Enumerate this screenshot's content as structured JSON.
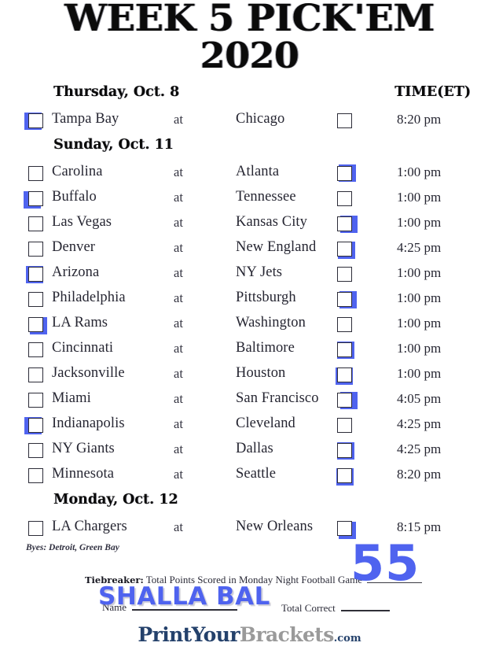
{
  "title": {
    "line1": "WEEK 5 PICK'EM",
    "line2": "2020"
  },
  "columns": {
    "time_header": "TIME(ET)",
    "at_word": "at"
  },
  "days": [
    {
      "label": "Thursday, Oct. 8",
      "games": [
        {
          "away": "Tampa Bay",
          "home": "Chicago",
          "time": "8:20 pm",
          "picked": "away"
        }
      ]
    },
    {
      "label": "Sunday, Oct. 11",
      "games": [
        {
          "away": "Carolina",
          "home": "Atlanta",
          "time": "1:00 pm",
          "picked": "home"
        },
        {
          "away": "Buffalo",
          "home": "Tennessee",
          "time": "1:00 pm",
          "picked": "away"
        },
        {
          "away": "Las Vegas",
          "home": "Kansas City",
          "time": "1:00 pm",
          "picked": "home"
        },
        {
          "away": "Denver",
          "home": "New England",
          "time": "4:25 pm",
          "picked": "home"
        },
        {
          "away": "Arizona",
          "home": "NY Jets",
          "time": "1:00 pm",
          "picked": "away"
        },
        {
          "away": "Philadelphia",
          "home": "Pittsburgh",
          "time": "1:00 pm",
          "picked": "home"
        },
        {
          "away": "LA Rams",
          "home": "Washington",
          "time": "1:00 pm",
          "picked": "away"
        },
        {
          "away": "Cincinnati",
          "home": "Baltimore",
          "time": "1:00 pm",
          "picked": "home"
        },
        {
          "away": "Jacksonville",
          "home": "Houston",
          "time": "1:00 pm",
          "picked": "home"
        },
        {
          "away": "Miami",
          "home": "San Francisco",
          "time": "4:05 pm",
          "picked": "home"
        },
        {
          "away": "Indianapolis",
          "home": "Cleveland",
          "time": "4:25 pm",
          "picked": "away"
        },
        {
          "away": "NY Giants",
          "home": "Dallas",
          "time": "4:25 pm",
          "picked": "home"
        },
        {
          "away": "Minnesota",
          "home": "Seattle",
          "time": "8:20 pm",
          "picked": "home"
        }
      ]
    },
    {
      "label": "Monday, Oct. 12",
      "games": [
        {
          "away": "LA Chargers",
          "home": "New Orleans",
          "time": "8:15 pm",
          "picked": "home"
        }
      ]
    }
  ],
  "footer": {
    "byes": "Byes: Detroit, Green Bay",
    "tiebreaker_label": "Tiebreaker:",
    "tiebreaker_text": "Total Points Scored in Monday Night Football Game",
    "name_label": "Name",
    "total_correct_label": "Total Correct",
    "handwritten_name": "SHALLA BAL",
    "handwritten_score": "55"
  },
  "logo": {
    "part1": "PrintYour",
    "part2": "Brackets",
    "part3": ".com"
  },
  "colors": {
    "mark_blue": "#4f63ef",
    "text": "#262632",
    "logo_navy": "#24416b",
    "logo_gray": "#9a9a9a"
  }
}
